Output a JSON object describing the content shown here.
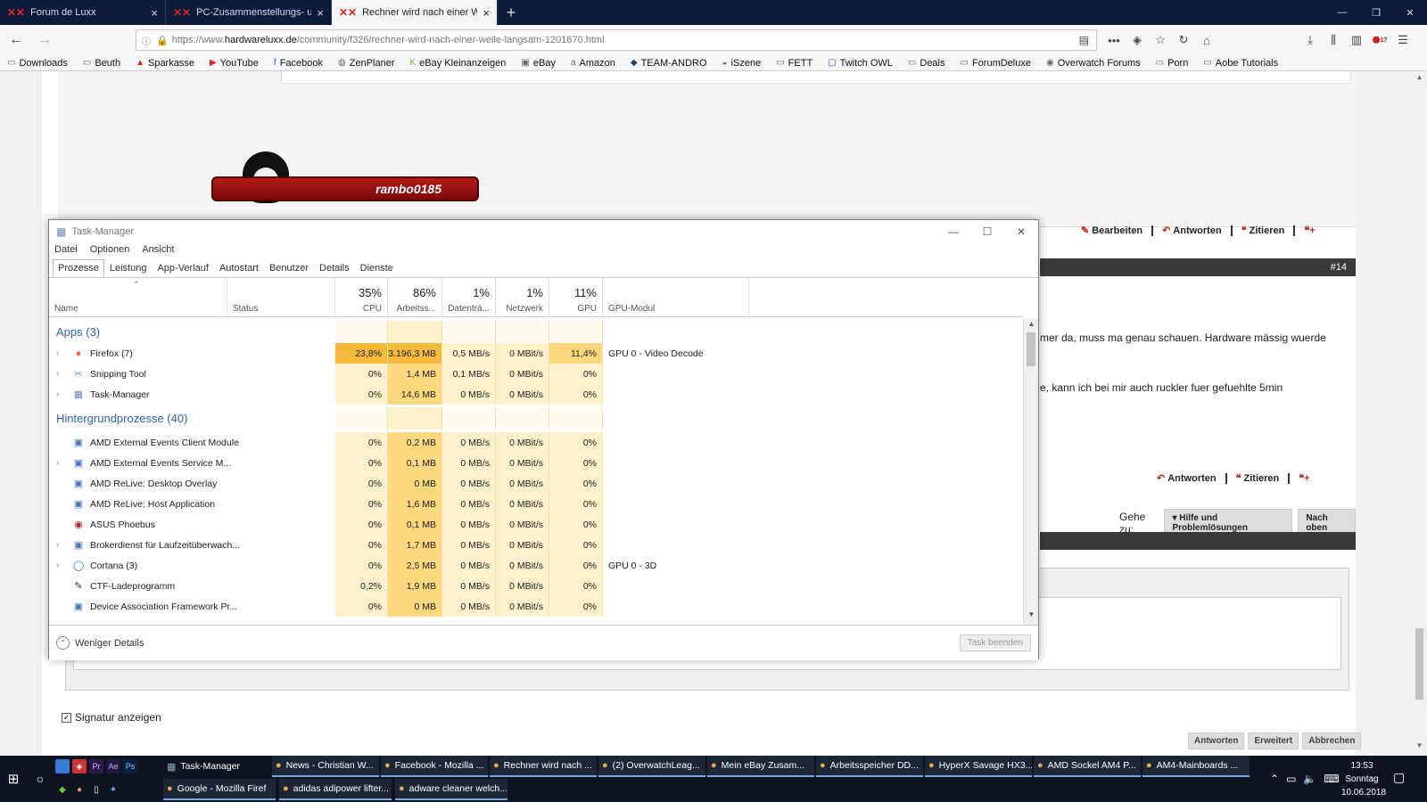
{
  "browser": {
    "tabs": [
      {
        "label": "Forum de Luxx",
        "active": false
      },
      {
        "label": "PC-Zusammenstellungs- und /",
        "active": false
      },
      {
        "label": "Rechner wird nach einer Weile",
        "active": true
      }
    ],
    "url": {
      "prefix": "https://www.",
      "domain": "hardwareluxx.de",
      "path": "/community/f326/rechner-wird-nach-einer-weile-langsam-1201670.html"
    },
    "badge_count": "17",
    "bookmarks": [
      "Downloads",
      "Beuth",
      "Sparkasse",
      "YouTube",
      "Facebook",
      "ZenPlaner",
      "eBay Kleinanzeigen",
      "eBay",
      "Amazon",
      "TEAM-ANDRO",
      "iSzene",
      "FETT",
      "Twitch OWL",
      "Deals",
      "ForumDeluxe",
      "Overwatch Forums",
      "Porn",
      "Aobe Tutorials"
    ]
  },
  "forum": {
    "signature_name": "rambo0185",
    "actions_top": {
      "edit": "Bearbeiten",
      "reply": "Antworten",
      "quote": "Zitieren"
    },
    "post_number": "#14",
    "post_text_1": "mer da, muss ma genau schauen. Hardware mässig wuerde",
    "post_text_2": "e, kann ich bei mir auch ruckler fuer gefuehlte 5min",
    "actions_bottom": {
      "reply": "Antworten",
      "quote": "Zitieren"
    },
    "goto_label": "Gehe zu:",
    "goto_select": "Hilfe und Problemlösungen",
    "goto_top": "Nach oben",
    "signature_checkbox": "Signatur anzeigen",
    "bottom_buttons": [
      "Antworten",
      "Erweitert",
      "Abbrechen"
    ]
  },
  "taskmanager": {
    "title": "Task-Manager",
    "menu": [
      "Datei",
      "Optionen",
      "Ansicht"
    ],
    "tabs": [
      "Prozesse",
      "Leistung",
      "App-Verlauf",
      "Autostart",
      "Benutzer",
      "Details",
      "Dienste"
    ],
    "columns": {
      "name": "Name",
      "status": "Status",
      "cpu": {
        "pct": "35%",
        "label": "CPU"
      },
      "mem": {
        "pct": "86%",
        "label": "Arbeitss..."
      },
      "disk": {
        "pct": "1%",
        "label": "Datenträ..."
      },
      "net": {
        "pct": "1%",
        "label": "Netzwerk"
      },
      "gpu": {
        "pct": "11%",
        "label": "GPU"
      },
      "gpumod": "GPU-Modul"
    },
    "groups": {
      "apps": "Apps (3)",
      "background": "Hintergrundprozesse (40)"
    },
    "apps": [
      {
        "name": "Firefox (7)",
        "icon": "firefox-icon",
        "expand": true,
        "cpu": "23,8%",
        "mem": "3.196,3 MB",
        "disk": "0,5 MB/s",
        "net": "0 MBit/s",
        "gpu": "11,4%",
        "gpumod": "GPU 0 - Video Decode"
      },
      {
        "name": "Snipping Tool",
        "icon": "scissors-icon",
        "expand": true,
        "cpu": "0%",
        "mem": "1,4 MB",
        "disk": "0,1 MB/s",
        "net": "0 MBit/s",
        "gpu": "0%",
        "gpumod": ""
      },
      {
        "name": "Task-Manager",
        "icon": "taskmanager-icon",
        "expand": true,
        "cpu": "0%",
        "mem": "14,6 MB",
        "disk": "0 MB/s",
        "net": "0 MBit/s",
        "gpu": "0%",
        "gpumod": ""
      }
    ],
    "background": [
      {
        "name": "AMD External Events Client Module",
        "icon": "service-icon",
        "expand": false,
        "cpu": "0%",
        "mem": "0,2 MB",
        "disk": "0 MB/s",
        "net": "0 MBit/s",
        "gpu": "0%",
        "gpumod": ""
      },
      {
        "name": "AMD External Events Service M...",
        "icon": "service-icon",
        "expand": true,
        "cpu": "0%",
        "mem": "0,1 MB",
        "disk": "0 MB/s",
        "net": "0 MBit/s",
        "gpu": "0%",
        "gpumod": ""
      },
      {
        "name": "AMD ReLive: Desktop Overlay",
        "icon": "service-icon",
        "expand": false,
        "cpu": "0%",
        "mem": "0 MB",
        "disk": "0 MB/s",
        "net": "0 MBit/s",
        "gpu": "0%",
        "gpumod": ""
      },
      {
        "name": "AMD ReLive: Host Application",
        "icon": "service-icon",
        "expand": false,
        "cpu": "0%",
        "mem": "1,6 MB",
        "disk": "0 MB/s",
        "net": "0 MBit/s",
        "gpu": "0%",
        "gpumod": ""
      },
      {
        "name": "ASUS Phoebus",
        "icon": "asus-icon",
        "expand": false,
        "cpu": "0%",
        "mem": "0,1 MB",
        "disk": "0 MB/s",
        "net": "0 MBit/s",
        "gpu": "0%",
        "gpumod": ""
      },
      {
        "name": "Brokerdienst für Laufzeitüberwach...",
        "icon": "service-icon",
        "expand": true,
        "cpu": "0%",
        "mem": "1,7 MB",
        "disk": "0 MB/s",
        "net": "0 MBit/s",
        "gpu": "0%",
        "gpumod": ""
      },
      {
        "name": "Cortana (3)",
        "icon": "cortana-icon",
        "expand": true,
        "cpu": "0%",
        "mem": "2,5 MB",
        "disk": "0 MB/s",
        "net": "0 MBit/s",
        "gpu": "0%",
        "gpumod": "GPU 0 - 3D"
      },
      {
        "name": "CTF-Ladeprogramm",
        "icon": "pen-icon",
        "expand": false,
        "cpu": "0,2%",
        "mem": "1,9 MB",
        "disk": "0 MB/s",
        "net": "0 MBit/s",
        "gpu": "0%",
        "gpumod": ""
      },
      {
        "name": "Device Association Framework Pr...",
        "icon": "service-icon",
        "expand": false,
        "cpu": "0%",
        "mem": "0 MB",
        "disk": "0 MB/s",
        "net": "0 MBit/s",
        "gpu": "0%",
        "gpumod": ""
      }
    ],
    "fewer_details": "Weniger Details",
    "end_task": "Task beenden"
  },
  "taskbar": {
    "row1": [
      "Task-Manager",
      "News - Christian W...",
      "Facebook - Mozilla ...",
      "Rechner wird nach ...",
      "(2) OverwatchLeag...",
      "Mein eBay Zusam...",
      "Arbeitsspeicher DD...",
      "HyperX Savage HX3...",
      "AMD Sockel AM4 P...",
      "AM4-Mainboards ..."
    ],
    "row2": [
      "Google - Mozilla Firef",
      "adidas adipower lifter...",
      "adware cleaner welch..."
    ],
    "time": "13:53",
    "day": "Sonntag",
    "date": "10.06.2018"
  },
  "colors": {
    "heat_high": "#f5b93b",
    "heat_mid": "#fbd77e",
    "heat_low": "#fdf2cc",
    "accent": "#2a62b4"
  }
}
